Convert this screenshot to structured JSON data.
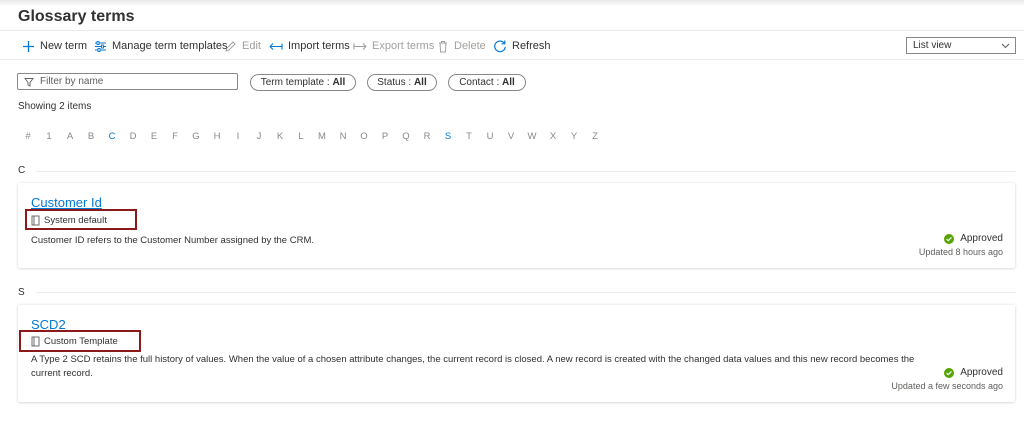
{
  "page": {
    "title": "Glossary terms"
  },
  "toolbar": {
    "new_term": "New term",
    "manage_templates": "Manage term templates",
    "edit": "Edit",
    "import_terms": "Import terms",
    "export_terms": "Export terms",
    "delete": "Delete",
    "refresh": "Refresh",
    "view_select": "List view"
  },
  "filters": {
    "filter_placeholder": "Filter by name",
    "term_template": {
      "label": "Term template : ",
      "value": "All"
    },
    "status": {
      "label": "Status : ",
      "value": "All"
    },
    "contact": {
      "label": "Contact : ",
      "value": "All"
    }
  },
  "showing": "Showing 2 items",
  "alphabet": [
    "#",
    "1",
    "A",
    "B",
    "C",
    "D",
    "E",
    "F",
    "G",
    "H",
    "I",
    "J",
    "K",
    "L",
    "M",
    "N",
    "O",
    "P",
    "Q",
    "R",
    "S",
    "T",
    "U",
    "V",
    "W",
    "X",
    "Y",
    "Z"
  ],
  "alphabet_active": [
    "C",
    "S"
  ],
  "groups": [
    {
      "letter": "C",
      "terms": [
        {
          "name": "Customer Id",
          "template": "System default",
          "description": "Customer ID refers to the Customer Number assigned by the CRM.",
          "status": "Approved",
          "updated": "Updated 8 hours ago"
        }
      ]
    },
    {
      "letter": "S",
      "terms": [
        {
          "name": "SCD2",
          "template": "Custom Template",
          "description": "A Type 2 SCD retains the full history of values. When the value of a chosen attribute changes, the current record is closed. A new record is created with the changed data values and this new record becomes the current record.",
          "status": "Approved",
          "updated": "Updated a few seconds ago"
        }
      ]
    }
  ],
  "colors": {
    "accent": "#0078d4",
    "approved": "#57a300",
    "highlight": "#8b1a1a"
  },
  "icons": [
    "add-icon",
    "settings-sliders-icon",
    "pencil-icon",
    "import-arrows-icon",
    "export-arrow-icon",
    "trash-icon",
    "refresh-icon",
    "chevron-down-icon",
    "filter-icon",
    "template-icon",
    "check-circle-icon"
  ]
}
